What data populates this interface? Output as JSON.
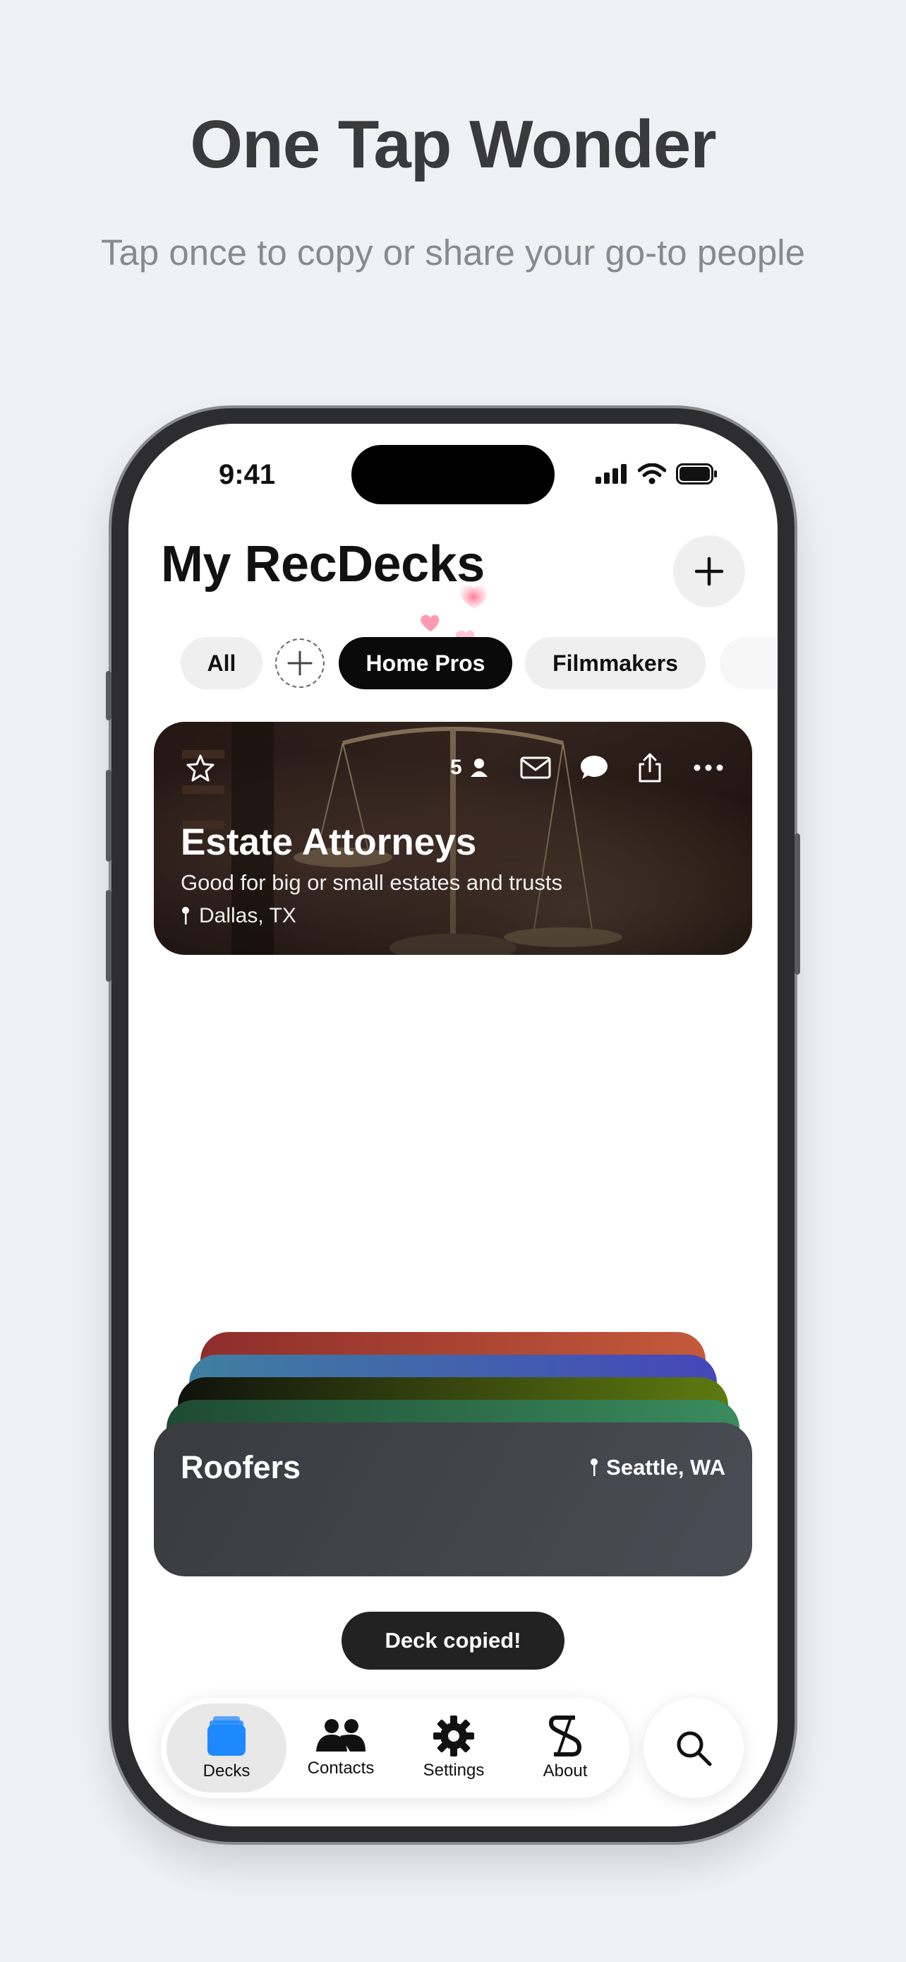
{
  "hero": {
    "title": "One Tap Wonder",
    "subtitle": "Tap once to copy or share your go-to people"
  },
  "status_bar": {
    "time": "9:41"
  },
  "header": {
    "title": "My RecDecks",
    "add_icon": "plus-icon"
  },
  "chips": [
    {
      "label": "All",
      "active": false
    },
    {
      "label": "Home Pros",
      "active": true
    },
    {
      "label": "Filmmakers",
      "active": false
    }
  ],
  "deck_card": {
    "title": "Estate Attorneys",
    "description": "Good for big or small estates and trusts",
    "location": "Dallas, TX",
    "member_count": "5",
    "icons": [
      "star-icon",
      "person-icon",
      "mail-icon",
      "message-icon",
      "share-icon",
      "more-icon"
    ]
  },
  "stacked_cards": {
    "front": {
      "title": "Roofers",
      "location": "Seattle, WA"
    }
  },
  "toast": {
    "message": "Deck copied!"
  },
  "tabbar": {
    "tabs": [
      {
        "label": "Decks",
        "icon": "decks-icon",
        "active": true
      },
      {
        "label": "Contacts",
        "icon": "contacts-icon",
        "active": false
      },
      {
        "label": "Settings",
        "icon": "gear-icon",
        "active": false
      },
      {
        "label": "About",
        "icon": "about-logo-icon",
        "active": false
      }
    ],
    "search_icon": "search-icon"
  },
  "colors": {
    "background": "#eff1f4",
    "active_chip": "#0a0a0a",
    "decks_icon": "#1e88ff",
    "toast": "#222222"
  }
}
